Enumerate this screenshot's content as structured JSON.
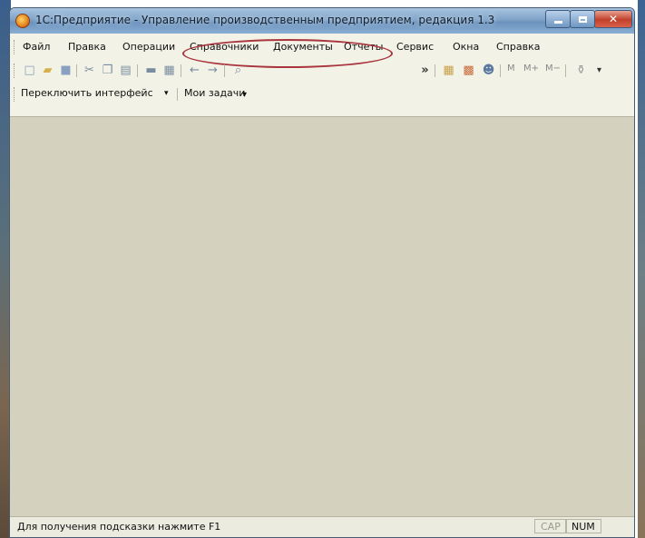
{
  "window": {
    "title": "1С:Предприятие - Управление производственным предприятием, редакция 1.3"
  },
  "menu": {
    "items": [
      {
        "label": "Файл"
      },
      {
        "label": "Правка"
      },
      {
        "label": "Операции"
      },
      {
        "label": "Справочники"
      },
      {
        "label": "Документы"
      },
      {
        "label": "Отчеты"
      },
      {
        "label": "Сервис"
      },
      {
        "label": "Окна"
      },
      {
        "label": "Справка"
      }
    ]
  },
  "toolbar": {
    "overflow_label": "»"
  },
  "toolbar2": {
    "switch_interface_label": "Переключить интерфейс",
    "switch_dropdown_glyph": "▾",
    "my_tasks_label": "Мои задачи"
  },
  "toolbar_right": {
    "m_label": "M",
    "mplus_label": "M+",
    "mminus_label": "M−"
  },
  "statusbar": {
    "hint": "Для получения подсказки нажмите F1",
    "cap": "CAP",
    "num": "NUM"
  },
  "colors": {
    "workspace": "#d5d1bf",
    "highlight": "#a8353d",
    "titlebar": "#7fa3c8"
  }
}
